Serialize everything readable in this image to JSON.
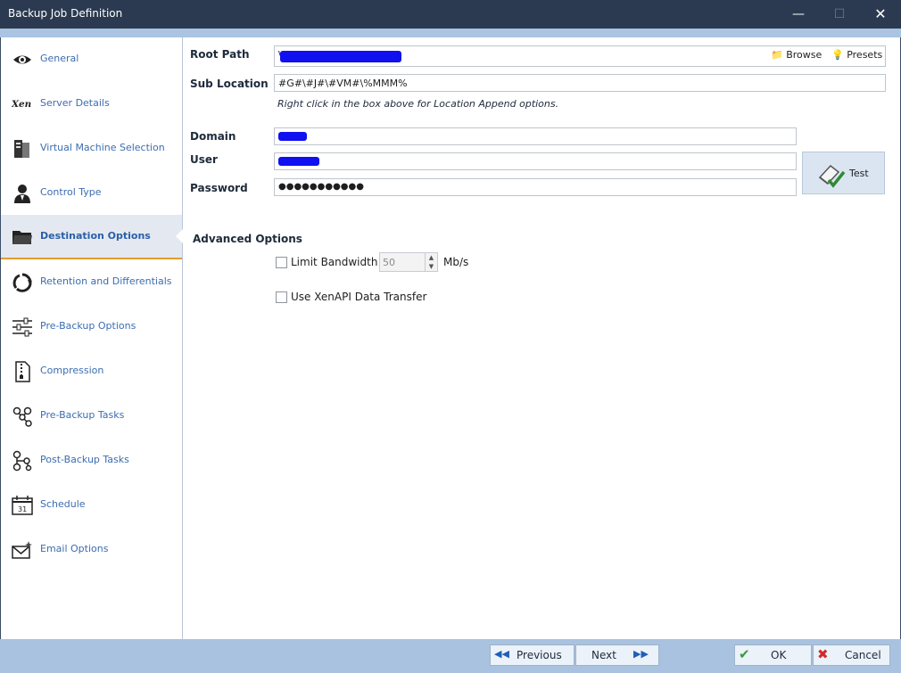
{
  "window": {
    "title": "Backup Job Definition",
    "min_icon": "minimize-icon",
    "max_icon": "maximize-icon",
    "close_icon": "close-icon"
  },
  "sidebar": {
    "items": [
      {
        "label": "General",
        "icon": "eye-icon"
      },
      {
        "label": "Server Details",
        "icon": "xen-logo-icon"
      },
      {
        "label": "Virtual Machine Selection",
        "icon": "server-icon"
      },
      {
        "label": "Control Type",
        "icon": "user-icon"
      },
      {
        "label": "Destination Options",
        "icon": "folder-icon",
        "active": true
      },
      {
        "label": "Retention and Differentials",
        "icon": "recycle-icon"
      },
      {
        "label": "Pre-Backup Options",
        "icon": "sliders-icon"
      },
      {
        "label": "Compression",
        "icon": "zip-file-icon"
      },
      {
        "label": "Pre-Backup Tasks",
        "icon": "tasks-icon"
      },
      {
        "label": "Post-Backup Tasks",
        "icon": "tasks-icon"
      },
      {
        "label": "Schedule",
        "icon": "calendar-icon"
      },
      {
        "label": "Email Options",
        "icon": "envelope-icon"
      }
    ],
    "active_color": "#e79b2e"
  },
  "form": {
    "root_path_label": "Root Path",
    "root_path_value": "\\",
    "browse_label": "Browse",
    "presets_label": "Presets",
    "sub_location_label": "Sub Location",
    "sub_location_value": "#G#\\#J#\\#VM#\\%MMM%",
    "sub_location_hint": "Right click in the box above for Location Append options.",
    "domain_label": "Domain",
    "user_label": "User",
    "password_label": "Password",
    "password_value": "●●●●●●●●●●●",
    "test_label": "Test"
  },
  "advanced": {
    "title": "Advanced Options",
    "limit_bandwidth_label": "Limit Bandwidth",
    "limit_bandwidth_checked": false,
    "bandwidth_value": "50",
    "bandwidth_unit": "Mb/s",
    "xenapi_label": "Use XenAPI Data Transfer",
    "xenapi_checked": false
  },
  "footer": {
    "previous_label": "Previous",
    "next_label": "Next",
    "ok_label": "OK",
    "cancel_label": "Cancel"
  },
  "colors": {
    "titlebar": "#2b3a50",
    "accent": "#aac4e2",
    "footer": "#a9c2df",
    "link": "#3b6db0",
    "redaction": "#1010f0"
  }
}
